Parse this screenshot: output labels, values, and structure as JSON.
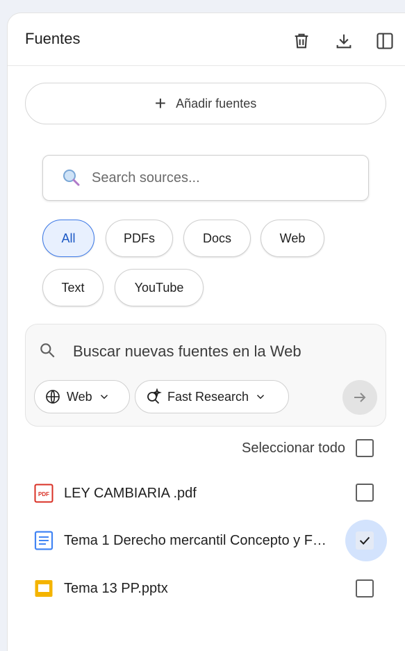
{
  "header": {
    "title": "Fuentes",
    "icons": [
      "trash-icon",
      "download-icon",
      "panel-toggle-icon"
    ]
  },
  "add_sources_label": "Añadir fuentes",
  "search": {
    "placeholder": "Search sources..."
  },
  "filters": [
    {
      "label": "All",
      "active": true
    },
    {
      "label": "PDFs",
      "active": false
    },
    {
      "label": "Docs",
      "active": false
    },
    {
      "label": "Web",
      "active": false
    },
    {
      "label": "Text",
      "active": false
    },
    {
      "label": "YouTube",
      "active": false
    }
  ],
  "web_search": {
    "prompt": "Buscar nuevas fuentes en la Web",
    "source_label": "Web",
    "mode_label": "Fast Research"
  },
  "select_all_label": "Seleccionar todo",
  "sources": [
    {
      "name": "LEY CAMBIARIA .pdf",
      "type": "pdf",
      "checked": false
    },
    {
      "name": "Tema 1 Derecho mercantil Concepto y F…",
      "type": "doc",
      "checked": true
    },
    {
      "name": "Tema 13 PP.pptx",
      "type": "slides",
      "checked": false
    }
  ],
  "colors": {
    "accent": "#1a57c4",
    "pdf": "#d93025",
    "doc": "#4285f4",
    "slides": "#f4b400"
  }
}
